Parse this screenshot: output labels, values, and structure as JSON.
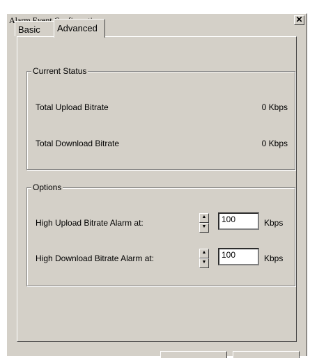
{
  "window": {
    "title": "Alarm Event Configuration"
  },
  "tabs": [
    {
      "label": "Basic"
    },
    {
      "label": "Advanced"
    }
  ],
  "current_status": {
    "legend": "Current Status",
    "rows": [
      {
        "label": "Total Upload Bitrate",
        "value": "0 Kbps"
      },
      {
        "label": "Total Download Bitrate",
        "value": "0 Kbps"
      }
    ]
  },
  "options": {
    "legend": "Options",
    "rows": [
      {
        "label": "High Upload Bitrate Alarm at:",
        "value": "100",
        "unit": "Kbps"
      },
      {
        "label": "High Download Bitrate Alarm at:",
        "value": "100",
        "unit": "Kbps"
      }
    ]
  },
  "icons": {
    "close": "close-icon",
    "up": "up-arrow-icon",
    "down": "down-arrow-icon"
  }
}
